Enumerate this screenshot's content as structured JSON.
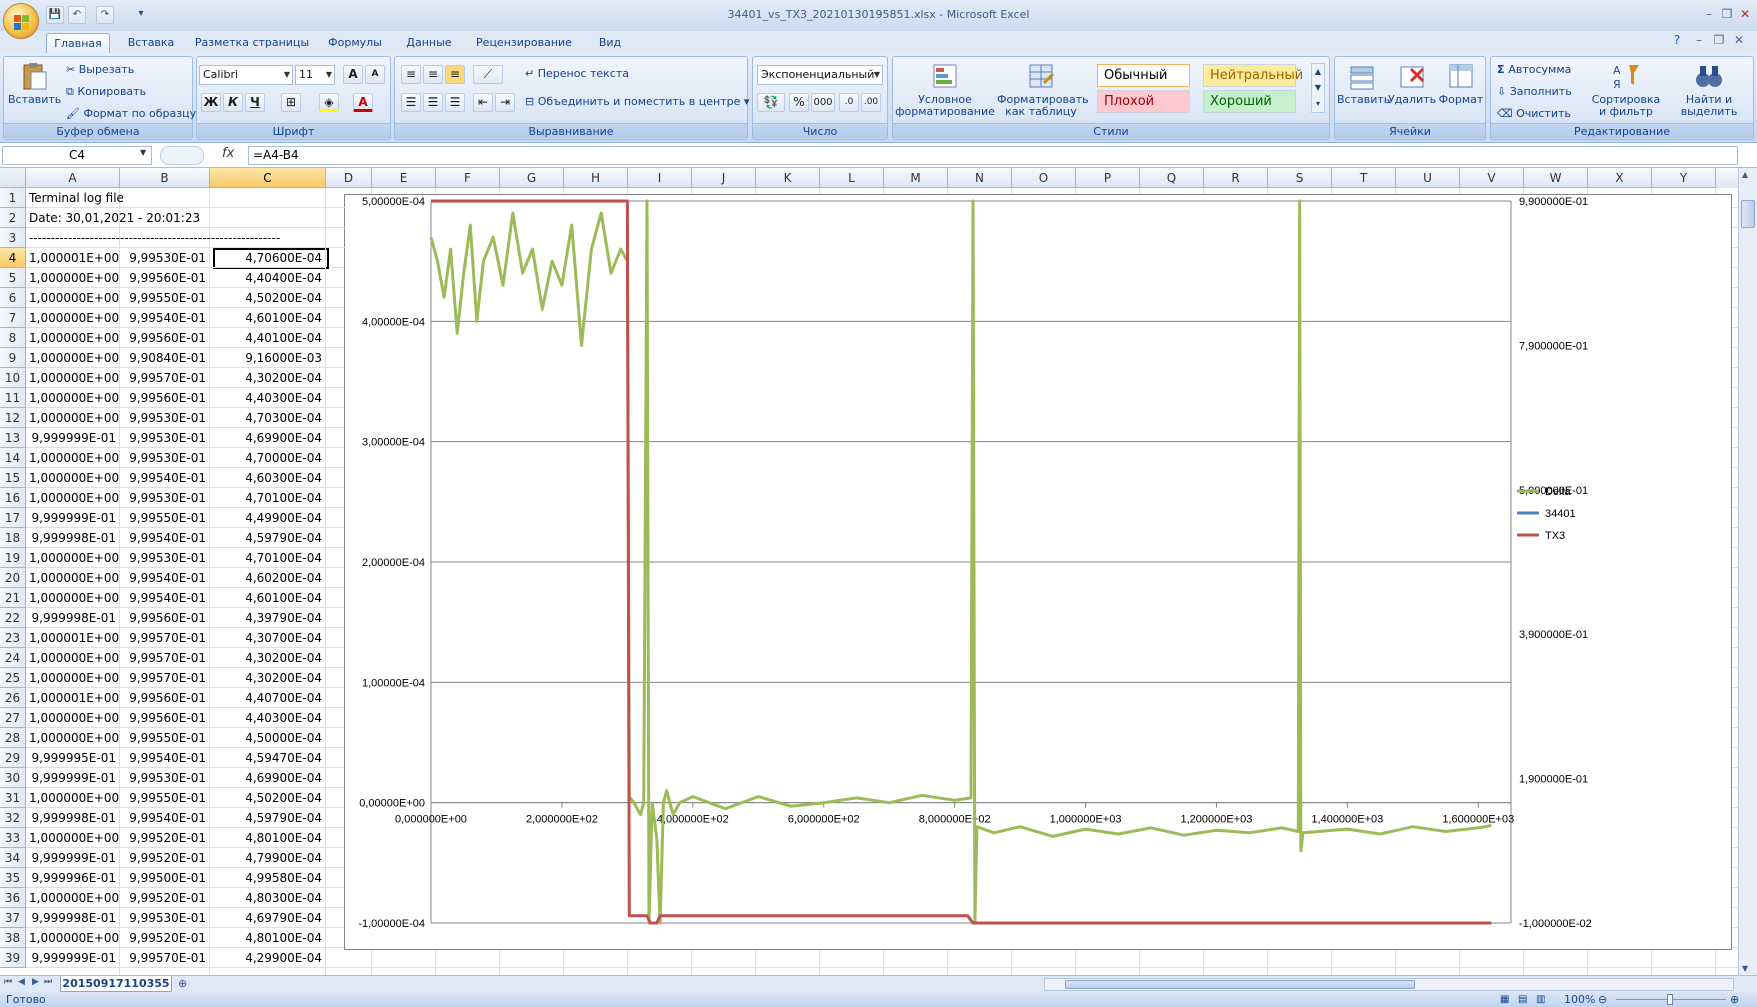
{
  "window": {
    "title": "34401_vs_TX3_20210130195851.xlsx - Microsoft Excel",
    "minimize": "–",
    "restore": "❐",
    "close": "✕",
    "doc_min": "–",
    "doc_restore": "❐",
    "doc_close": "✕",
    "help": "?"
  },
  "qat": {
    "save": "💾",
    "undo": "↶",
    "redo": "↷",
    "more": "▾"
  },
  "tabs": [
    "Главная",
    "Вставка",
    "Разметка страницы",
    "Формулы",
    "Данные",
    "Рецензирование",
    "Вид"
  ],
  "ribbon": {
    "clipboard": {
      "label": "Буфер обмена",
      "paste": "Вставить",
      "cut": "Вырезать",
      "copy": "Копировать",
      "format_painter": "Формат по образцу"
    },
    "font": {
      "label": "Шрифт",
      "name": "Calibri",
      "size": "11",
      "grow": "A",
      "shrink": "A",
      "bold": "Ж",
      "italic": "К",
      "underline": "Ч"
    },
    "alignment": {
      "label": "Выравнивание",
      "wrap": "Перенос текста",
      "merge": "Объединить и поместить в центре"
    },
    "number": {
      "label": "Число",
      "format": "Экспоненциальный",
      "percent": "%",
      "thousands": "000"
    },
    "styles": {
      "label": "Стили",
      "conditional": "Условное форматирование",
      "as_table": "Форматировать как таблицу",
      "normal": "Обычный",
      "neutral": "Нейтральный",
      "bad": "Плохой",
      "good": "Хороший"
    },
    "cells": {
      "label": "Ячейки",
      "insert": "Вставить",
      "delete": "Удалить",
      "format": "Формат"
    },
    "editing": {
      "label": "Редактирование",
      "autosum": "Автосумма",
      "fill": "Заполнить",
      "clear": "Очистить",
      "sort": "Сортировка и фильтр",
      "find": "Найти и выделить"
    }
  },
  "formula_bar": {
    "name_box": "C4",
    "fx": "fx",
    "formula": "=A4-B4"
  },
  "columns": [
    "A",
    "B",
    "C",
    "D",
    "E",
    "F",
    "G",
    "H",
    "I",
    "J",
    "K",
    "L",
    "M",
    "N",
    "O",
    "P",
    "Q",
    "R",
    "S",
    "T",
    "U",
    "V",
    "W",
    "X",
    "Y"
  ],
  "selected_column": "C",
  "selected_row": 4,
  "rows": [
    {
      "n": "1",
      "a": "Terminal log file",
      "b": "",
      "c": ""
    },
    {
      "n": "2",
      "a": "Date: 30,01,2021 - 20:01:23",
      "b": "",
      "c": ""
    },
    {
      "n": "3",
      "a": "----------------------------------------------------------",
      "b": "",
      "c": ""
    },
    {
      "n": "4",
      "a": "1,000001E+00",
      "b": "9,99530E-01",
      "c": "4,70600E-04"
    },
    {
      "n": "5",
      "a": "1,000000E+00",
      "b": "9,99560E-01",
      "c": "4,40400E-04"
    },
    {
      "n": "6",
      "a": "1,000000E+00",
      "b": "9,99550E-01",
      "c": "4,50200E-04"
    },
    {
      "n": "7",
      "a": "1,000000E+00",
      "b": "9,99540E-01",
      "c": "4,60100E-04"
    },
    {
      "n": "8",
      "a": "1,000000E+00",
      "b": "9,99560E-01",
      "c": "4,40100E-04"
    },
    {
      "n": "9",
      "a": "1,000000E+00",
      "b": "9,90840E-01",
      "c": "9,16000E-03"
    },
    {
      "n": "10",
      "a": "1,000000E+00",
      "b": "9,99570E-01",
      "c": "4,30200E-04"
    },
    {
      "n": "11",
      "a": "1,000000E+00",
      "b": "9,99560E-01",
      "c": "4,40300E-04"
    },
    {
      "n": "12",
      "a": "1,000000E+00",
      "b": "9,99530E-01",
      "c": "4,70300E-04"
    },
    {
      "n": "13",
      "a": "9,999999E-01",
      "b": "9,99530E-01",
      "c": "4,69900E-04"
    },
    {
      "n": "14",
      "a": "1,000000E+00",
      "b": "9,99530E-01",
      "c": "4,70000E-04"
    },
    {
      "n": "15",
      "a": "1,000000E+00",
      "b": "9,99540E-01",
      "c": "4,60300E-04"
    },
    {
      "n": "16",
      "a": "1,000000E+00",
      "b": "9,99530E-01",
      "c": "4,70100E-04"
    },
    {
      "n": "17",
      "a": "9,999999E-01",
      "b": "9,99550E-01",
      "c": "4,49900E-04"
    },
    {
      "n": "18",
      "a": "9,999998E-01",
      "b": "9,99540E-01",
      "c": "4,59790E-04"
    },
    {
      "n": "19",
      "a": "1,000000E+00",
      "b": "9,99530E-01",
      "c": "4,70100E-04"
    },
    {
      "n": "20",
      "a": "1,000000E+00",
      "b": "9,99540E-01",
      "c": "4,60200E-04"
    },
    {
      "n": "21",
      "a": "1,000000E+00",
      "b": "9,99540E-01",
      "c": "4,60100E-04"
    },
    {
      "n": "22",
      "a": "9,999998E-01",
      "b": "9,99560E-01",
      "c": "4,39790E-04"
    },
    {
      "n": "23",
      "a": "1,000001E+00",
      "b": "9,99570E-01",
      "c": "4,30700E-04"
    },
    {
      "n": "24",
      "a": "1,000000E+00",
      "b": "9,99570E-01",
      "c": "4,30200E-04"
    },
    {
      "n": "25",
      "a": "1,000000E+00",
      "b": "9,99570E-01",
      "c": "4,30200E-04"
    },
    {
      "n": "26",
      "a": "1,000001E+00",
      "b": "9,99560E-01",
      "c": "4,40700E-04"
    },
    {
      "n": "27",
      "a": "1,000000E+00",
      "b": "9,99560E-01",
      "c": "4,40300E-04"
    },
    {
      "n": "28",
      "a": "1,000000E+00",
      "b": "9,99550E-01",
      "c": "4,50000E-04"
    },
    {
      "n": "29",
      "a": "9,999995E-01",
      "b": "9,99540E-01",
      "c": "4,59470E-04"
    },
    {
      "n": "30",
      "a": "9,999999E-01",
      "b": "9,99530E-01",
      "c": "4,69900E-04"
    },
    {
      "n": "31",
      "a": "1,000000E+00",
      "b": "9,99550E-01",
      "c": "4,50200E-04"
    },
    {
      "n": "32",
      "a": "9,999998E-01",
      "b": "9,99540E-01",
      "c": "4,59790E-04"
    },
    {
      "n": "33",
      "a": "1,000000E+00",
      "b": "9,99520E-01",
      "c": "4,80100E-04"
    },
    {
      "n": "34",
      "a": "9,999999E-01",
      "b": "9,99520E-01",
      "c": "4,79900E-04"
    },
    {
      "n": "35",
      "a": "9,999996E-01",
      "b": "9,99500E-01",
      "c": "4,99580E-04"
    },
    {
      "n": "36",
      "a": "1,000000E+00",
      "b": "9,99520E-01",
      "c": "4,80300E-04"
    },
    {
      "n": "37",
      "a": "9,999998E-01",
      "b": "9,99530E-01",
      "c": "4,69790E-04"
    },
    {
      "n": "38",
      "a": "1,000000E+00",
      "b": "9,99520E-01",
      "c": "4,80100E-04"
    },
    {
      "n": "39",
      "a": "9,999999E-01",
      "b": "9,99570E-01",
      "c": "4,29900E-04"
    }
  ],
  "chart_data": {
    "type": "line",
    "x_ticks": [
      "0,000000E+00",
      "2,000000E+02",
      "4,000000E+02",
      "6,000000E+02",
      "8,000000E+02",
      "1,000000E+03",
      "1,200000E+03",
      "1,400000E+03",
      "1,600000E+03"
    ],
    "xlim": [
      0,
      1650
    ],
    "y_left_ticks": [
      "5,00000E-04",
      "4,00000E-04",
      "3,00000E-04",
      "2,00000E-04",
      "1,00000E-04",
      "0,00000E+00",
      "-1,00000E-04"
    ],
    "ylim_left": [
      -0.0001,
      0.0005
    ],
    "y_right_ticks": [
      "9,900000E-01",
      "7,900000E-01",
      "5,900000E-01",
      "3,900000E-01",
      "1,900000E-01",
      "-1,000000E-02"
    ],
    "ylim_right": [
      -0.01,
      0.99
    ],
    "grid": "horizontal",
    "legend_position": "right",
    "series": [
      {
        "name": "Delta",
        "color": "#9bbb59",
        "axis": "left",
        "points": [
          [
            0,
            0.00047
          ],
          [
            10,
            0.00045
          ],
          [
            20,
            0.00042
          ],
          [
            30,
            0.00046
          ],
          [
            40,
            0.00039
          ],
          [
            50,
            0.00044
          ],
          [
            60,
            0.00048
          ],
          [
            70,
            0.0004
          ],
          [
            80,
            0.00045
          ],
          [
            95,
            0.00047
          ],
          [
            110,
            0.00043
          ],
          [
            125,
            0.00049
          ],
          [
            140,
            0.00044
          ],
          [
            155,
            0.00046
          ],
          [
            170,
            0.00041
          ],
          [
            185,
            0.00045
          ],
          [
            200,
            0.00043
          ],
          [
            215,
            0.00048
          ],
          [
            230,
            0.00038
          ],
          [
            245,
            0.00046
          ],
          [
            260,
            0.00049
          ],
          [
            275,
            0.00044
          ],
          [
            290,
            0.00046
          ],
          [
            300,
            0.00045
          ],
          [
            303,
            5e-06
          ],
          [
            310,
            0.0
          ],
          [
            320,
            -1e-05
          ],
          [
            325,
            0.0
          ],
          [
            330,
            0.0005
          ],
          [
            333,
            -0.0001
          ],
          [
            338,
            0.0
          ],
          [
            345,
            -3e-05
          ],
          [
            350,
            -0.0001
          ],
          [
            355,
            0.0
          ],
          [
            360,
            1e-05
          ],
          [
            370,
            -1e-05
          ],
          [
            380,
            0.0
          ],
          [
            400,
            5e-06
          ],
          [
            450,
            -5e-06
          ],
          [
            500,
            5e-06
          ],
          [
            550,
            -3e-06
          ],
          [
            600,
            0.0
          ],
          [
            650,
            4e-06
          ],
          [
            700,
            0.0
          ],
          [
            750,
            6e-06
          ],
          [
            800,
            2e-06
          ],
          [
            825,
            4e-06
          ],
          [
            828,
            0.0005
          ],
          [
            831,
            -0.0001
          ],
          [
            834,
            -2e-05
          ],
          [
            860,
            -2.5e-05
          ],
          [
            900,
            -2e-05
          ],
          [
            950,
            -2.8e-05
          ],
          [
            1000,
            -2.2e-05
          ],
          [
            1050,
            -2.6e-05
          ],
          [
            1100,
            -2.1e-05
          ],
          [
            1150,
            -2.7e-05
          ],
          [
            1200,
            -2.3e-05
          ],
          [
            1250,
            -2.5e-05
          ],
          [
            1300,
            -2.1e-05
          ],
          [
            1325,
            -2.4e-05
          ],
          [
            1327,
            0.0005
          ],
          [
            1329,
            -4e-05
          ],
          [
            1332,
            -2.5e-05
          ],
          [
            1400,
            -2.2e-05
          ],
          [
            1450,
            -2.6e-05
          ],
          [
            1500,
            -2e-05
          ],
          [
            1550,
            -2.4e-05
          ],
          [
            1600,
            -2.1e-05
          ],
          [
            1620,
            -1.9e-05
          ]
        ]
      },
      {
        "name": "34401",
        "color": "#4f81bd",
        "axis": "right",
        "points": [
          [
            0,
            0.999
          ],
          [
            300,
            0.999
          ]
        ]
      },
      {
        "name": "TX3",
        "color": "#c0504d",
        "axis": "right",
        "points": [
          [
            0,
            0.999
          ],
          [
            300,
            0.999
          ],
          [
            303,
            0.0
          ],
          [
            330,
            0.0
          ],
          [
            335,
            -0.11
          ],
          [
            345,
            -0.02
          ],
          [
            350,
            0.0
          ],
          [
            820,
            0.0
          ],
          [
            828,
            -0.09
          ],
          [
            1320,
            -0.09
          ],
          [
            1326,
            -0.1
          ],
          [
            1620,
            -0.1
          ]
        ]
      }
    ]
  },
  "sheet": {
    "tab": "20150917110355"
  },
  "status": {
    "ready": "Готово",
    "zoom": "100%",
    "minus": "⊖",
    "plus": "⊕"
  }
}
